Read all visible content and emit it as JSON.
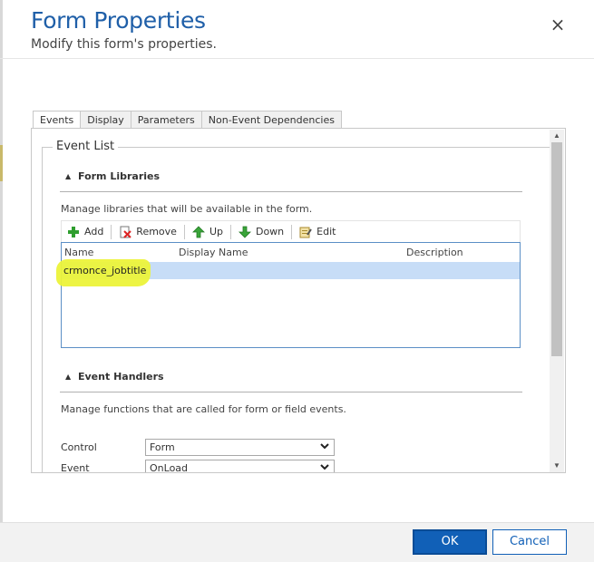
{
  "dialog": {
    "title": "Form Properties",
    "subtitle": "Modify this form's properties.",
    "close_glyph": "×"
  },
  "tabs": [
    {
      "label": "Events",
      "active": true
    },
    {
      "label": "Display",
      "active": false
    },
    {
      "label": "Parameters",
      "active": false
    },
    {
      "label": "Non-Event Dependencies",
      "active": false
    }
  ],
  "event_list": {
    "legend": "Event List",
    "form_libraries": {
      "heading": "Form Libraries",
      "description": "Manage libraries that will be available in the form.",
      "toolbar": {
        "add": "Add",
        "remove": "Remove",
        "up": "Up",
        "down": "Down",
        "edit": "Edit"
      },
      "columns": [
        "Name",
        "Display Name",
        "Description"
      ],
      "rows": [
        {
          "name": "crmonce_jobtitle",
          "display_name": "",
          "description": ""
        }
      ]
    },
    "event_handlers": {
      "heading": "Event Handlers",
      "description": "Manage functions that are called for form or field events.",
      "control_label": "Control",
      "control_value": "Form",
      "event_label": "Event",
      "event_value": "OnLoad"
    }
  },
  "footer": {
    "ok_label": "OK",
    "cancel_label": "Cancel"
  },
  "colors": {
    "title": "#1f5fa8",
    "primary_button": "#1160b7",
    "selected_row": "#c7ddf7",
    "annotation_highlight": "#ecf33a"
  },
  "icons": {
    "add": "plus-icon",
    "remove": "remove-icon",
    "up": "arrow-up-icon",
    "down": "arrow-down-icon",
    "edit": "edit-icon",
    "close": "close-icon"
  }
}
